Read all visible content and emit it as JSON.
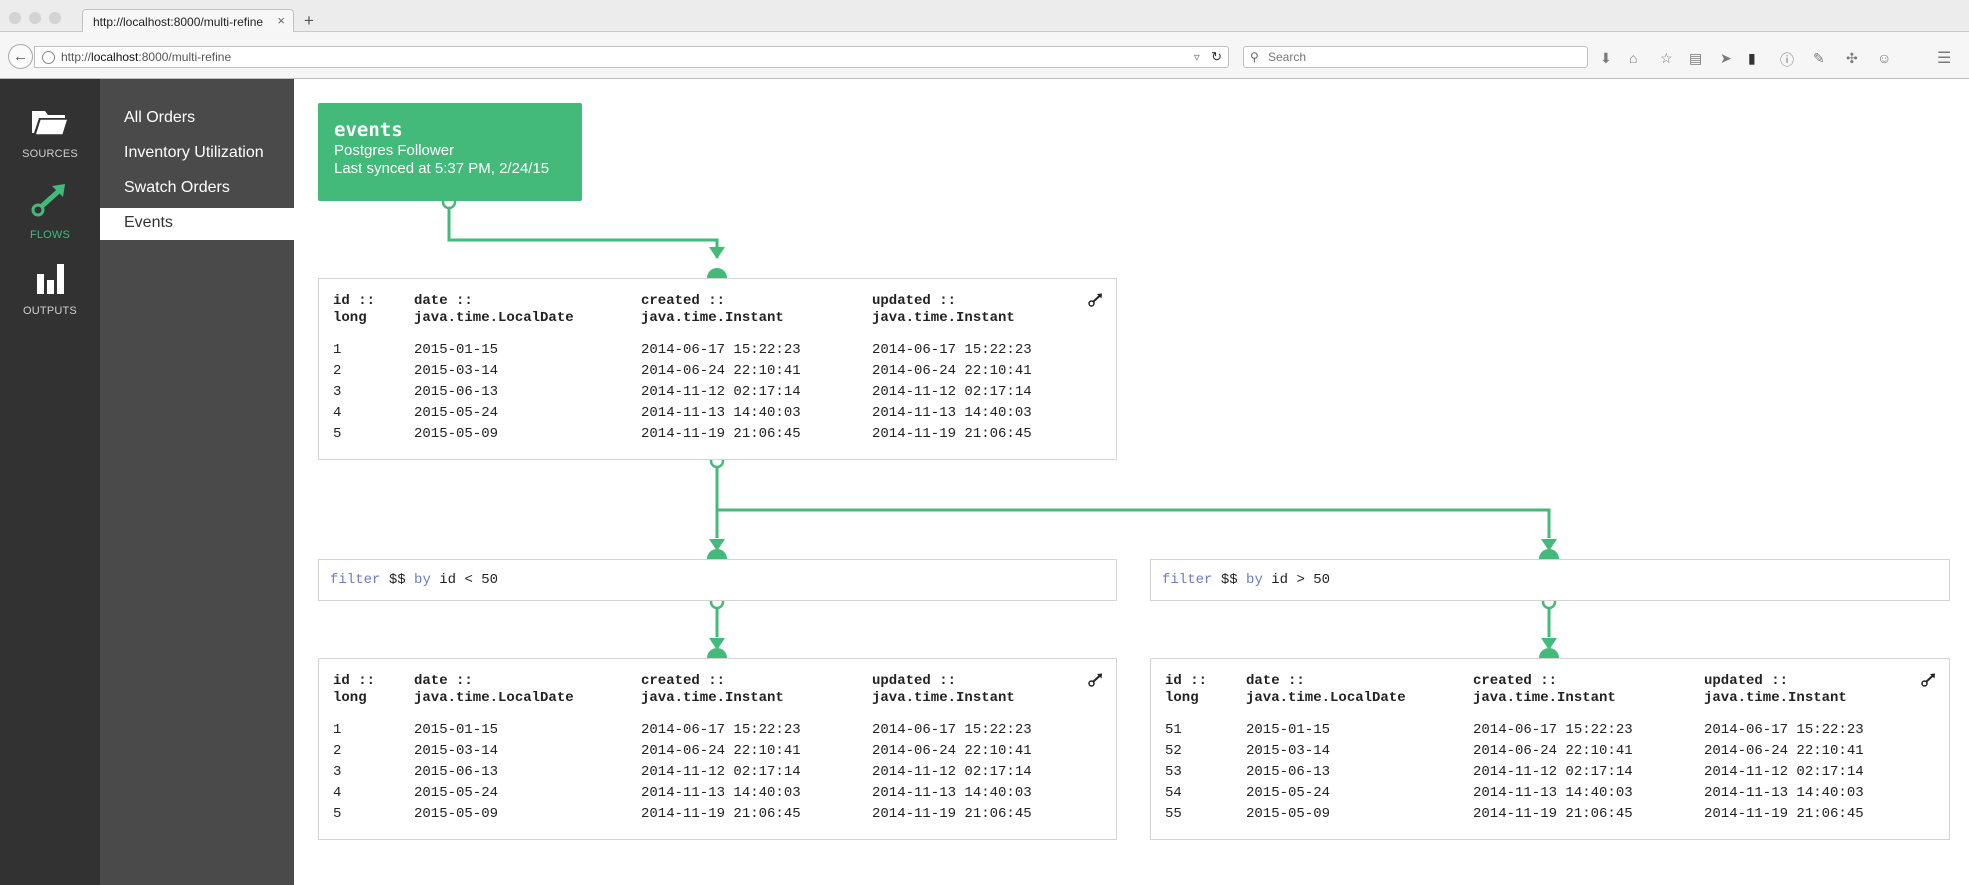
{
  "browser": {
    "tab_title": "http://localhost:8000/multi-refine",
    "tab_close": "×",
    "new_tab": "+",
    "url_prefix": "http://",
    "url_host": "localhost",
    "url_rest": ":8000/multi-refine",
    "search_placeholder": "Search"
  },
  "leftbar": {
    "items": [
      {
        "label": "SOURCES",
        "icon": "folder-icon"
      },
      {
        "label": "FLOWS",
        "icon": "flow-icon"
      },
      {
        "label": "OUTPUTS",
        "icon": "bar-chart-icon"
      }
    ],
    "active": "FLOWS"
  },
  "sidebar": {
    "items": [
      {
        "label": "All Orders"
      },
      {
        "label": "Inventory Utilization"
      },
      {
        "label": "Swatch Orders"
      },
      {
        "label": "Events"
      }
    ],
    "active": "Events"
  },
  "source": {
    "title": "events",
    "subtitle": "Postgres Follower",
    "synced": "Last synced at 5:37 PM, 2/24/15"
  },
  "tables": [
    {
      "headers": [
        {
          "l1": "id ::",
          "l2": "long"
        },
        {
          "l1": "date ::",
          "l2": "java.time.LocalDate"
        },
        {
          "l1": "created ::",
          "l2": "java.time.Instant"
        },
        {
          "l1": "updated ::",
          "l2": "java.time.Instant"
        }
      ],
      "rows": [
        [
          "1",
          "2015-01-15",
          "2014-06-17 15:22:23",
          "2014-06-17 15:22:23"
        ],
        [
          "2",
          "2015-03-14",
          "2014-06-24 22:10:41",
          "2014-06-24 22:10:41"
        ],
        [
          "3",
          "2015-06-13",
          "2014-11-12 02:17:14",
          "2014-11-12 02:17:14"
        ],
        [
          "4",
          "2015-05-24",
          "2014-11-13 14:40:03",
          "2014-11-13 14:40:03"
        ],
        [
          "5",
          "2015-05-09",
          "2014-11-19 21:06:45",
          "2014-11-19 21:06:45"
        ]
      ]
    },
    {
      "headers": [
        {
          "l1": "id ::",
          "l2": "long"
        },
        {
          "l1": "date ::",
          "l2": "java.time.LocalDate"
        },
        {
          "l1": "created ::",
          "l2": "java.time.Instant"
        },
        {
          "l1": "updated ::",
          "l2": "java.time.Instant"
        }
      ],
      "rows": [
        [
          "1",
          "2015-01-15",
          "2014-06-17 15:22:23",
          "2014-06-17 15:22:23"
        ],
        [
          "2",
          "2015-03-14",
          "2014-06-24 22:10:41",
          "2014-06-24 22:10:41"
        ],
        [
          "3",
          "2015-06-13",
          "2014-11-12 02:17:14",
          "2014-11-12 02:17:14"
        ],
        [
          "4",
          "2015-05-24",
          "2014-11-13 14:40:03",
          "2014-11-13 14:40:03"
        ],
        [
          "5",
          "2015-05-09",
          "2014-11-19 21:06:45",
          "2014-11-19 21:06:45"
        ]
      ]
    },
    {
      "headers": [
        {
          "l1": "id ::",
          "l2": "long"
        },
        {
          "l1": "date ::",
          "l2": "java.time.LocalDate"
        },
        {
          "l1": "created ::",
          "l2": "java.time.Instant"
        },
        {
          "l1": "updated ::",
          "l2": "java.time.Instant"
        }
      ],
      "rows": [
        [
          "51",
          "2015-01-15",
          "2014-06-17 15:22:23",
          "2014-06-17 15:22:23"
        ],
        [
          "52",
          "2015-03-14",
          "2014-06-24 22:10:41",
          "2014-06-24 22:10:41"
        ],
        [
          "53",
          "2015-06-13",
          "2014-11-12 02:17:14",
          "2014-11-12 02:17:14"
        ],
        [
          "54",
          "2015-05-24",
          "2014-11-13 14:40:03",
          "2014-11-13 14:40:03"
        ],
        [
          "55",
          "2015-05-09",
          "2014-11-19 21:06:45",
          "2014-11-19 21:06:45"
        ]
      ]
    }
  ],
  "filters": [
    {
      "kw1": "filter",
      "var": "$$",
      "kw2": "by",
      "expr": "id < 50"
    },
    {
      "kw1": "filter",
      "var": "$$",
      "kw2": "by",
      "expr": "id > 50"
    }
  ],
  "colors": {
    "accent": "#43b97a",
    "leftbar_bg": "#323232",
    "sidebar_bg": "#4a4a4a",
    "keyword": "#6d7cc4"
  }
}
